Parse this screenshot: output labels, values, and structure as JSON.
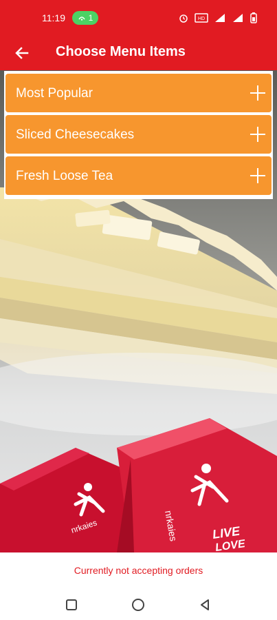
{
  "status_bar": {
    "time": "11:19",
    "pill_count": "1",
    "icons": [
      "alarm-icon",
      "hd-icon",
      "signal-icon",
      "battery-icon"
    ]
  },
  "app_bar": {
    "title": "Choose Menu Items",
    "back_icon": "arrow-left-icon"
  },
  "menu": {
    "items": [
      {
        "label": "Most Popular",
        "icon": "plus-icon"
      },
      {
        "label": "Sliced Cheesecakes",
        "icon": "plus-icon"
      },
      {
        "label": "Fresh Loose Tea",
        "icon": "plus-icon"
      }
    ]
  },
  "hero": {
    "box_text_1": "nrkaies",
    "box_text_2": "nrkaies",
    "box_text_3": "LIVE",
    "box_text_4": "LOVE"
  },
  "footer": {
    "notice": "Currently not accepting orders"
  },
  "colors": {
    "brand": "#e11b22",
    "accent": "#f7962e"
  },
  "nav": {
    "buttons": [
      "recents-square-icon",
      "home-circle-icon",
      "back-triangle-icon"
    ]
  }
}
